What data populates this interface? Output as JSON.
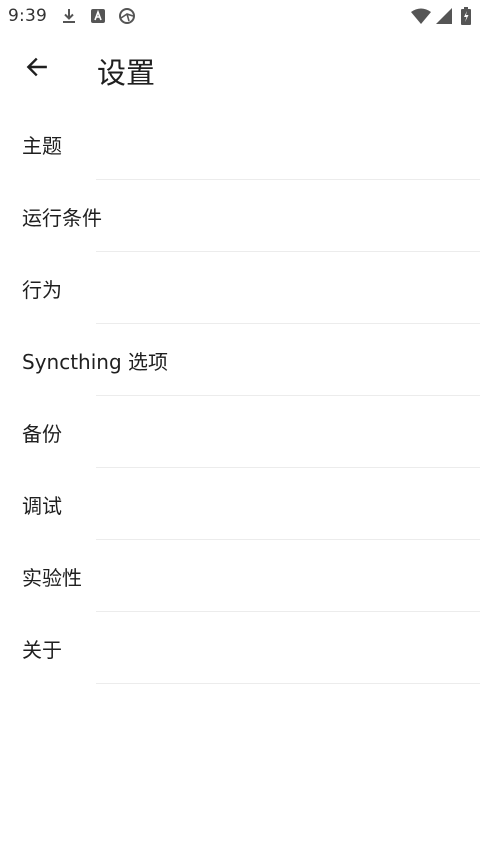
{
  "status_bar": {
    "time": "9:39",
    "icons": [
      "download-icon",
      "a-letter-icon",
      "syncthing-icon",
      "wifi-icon",
      "signal-icon",
      "battery-charging-icon"
    ]
  },
  "app_bar": {
    "title": "设置",
    "back_icon": "arrow-back-icon"
  },
  "settings": {
    "items": [
      {
        "label": "主题"
      },
      {
        "label": "运行条件"
      },
      {
        "label": "行为"
      },
      {
        "label": "Syncthing 选项"
      },
      {
        "label": "备份"
      },
      {
        "label": "调试"
      },
      {
        "label": "实验性"
      },
      {
        "label": "关于"
      }
    ]
  },
  "colors": {
    "text": "#1f1f1f",
    "divider": "#ececec",
    "background": "#ffffff",
    "status_icons": "#555555"
  }
}
